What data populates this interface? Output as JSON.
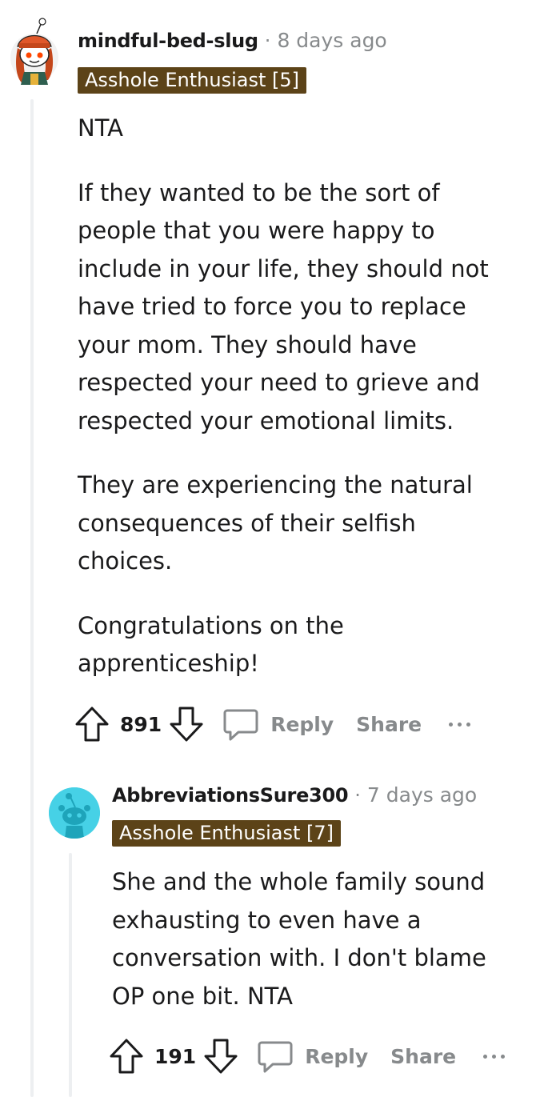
{
  "comments": [
    {
      "username": "mindful-bed-slug",
      "separator": "·",
      "time": "8 days ago",
      "flair": "Asshole Enthusiast [5]",
      "avatar": "snoo-avatar-redhead-icon",
      "paragraphs": [
        "NTA",
        "If they wanted to be the sort of people that you were happy to include in your life, they should not have tried to force you to replace your mom. They should have respected your need to grieve and respected your emotional limits.",
        "They are experiencing the natural consequences of their selfish choices.",
        "Congratulations on the apprenticeship!"
      ],
      "votes": "891",
      "reply_label": "Reply",
      "share_label": "Share"
    },
    {
      "username": "AbbreviationsSure300",
      "separator": "·",
      "time": "7 days ago",
      "flair": "Asshole Enthusiast [7]",
      "avatar": "default-snoo-avatar-icon",
      "paragraphs": [
        "She and the whole family sound exhausting to even have a conversation with. I don't blame OP one bit. NTA"
      ],
      "votes": "191",
      "reply_label": "Reply",
      "share_label": "Share"
    }
  ],
  "colors": {
    "flair_bg": "#5c4318",
    "meta_gray": "#878a8c",
    "thread_line": "#edeff1",
    "avatar2_bg": "#46d1e6"
  }
}
